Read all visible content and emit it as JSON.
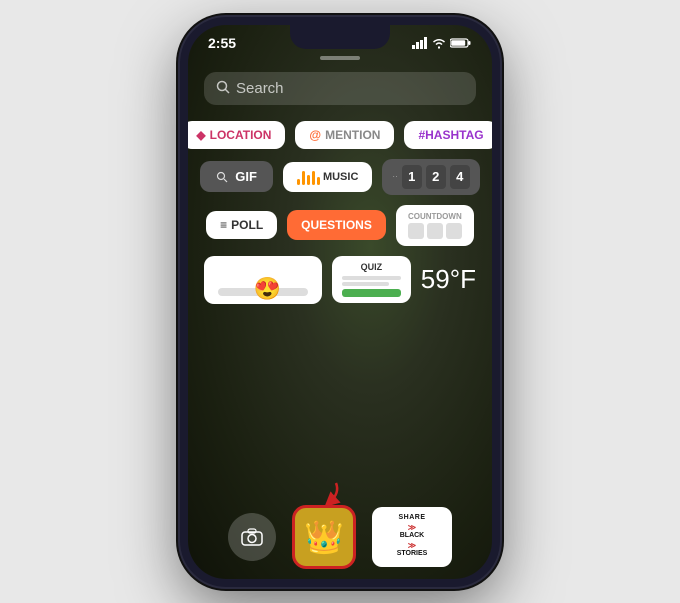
{
  "phone": {
    "status_bar": {
      "time": "2:55",
      "signal_icon": "signal",
      "wifi_icon": "wifi",
      "battery_icon": "battery"
    },
    "search": {
      "placeholder": "Search"
    },
    "stickers": {
      "row1": [
        {
          "id": "location",
          "label": "LOCATION",
          "type": "location"
        },
        {
          "id": "mention",
          "label": "@MENTION",
          "type": "mention"
        },
        {
          "id": "hashtag",
          "label": "#HASHTAG",
          "type": "hashtag"
        }
      ],
      "row2": [
        {
          "id": "gif",
          "label": "GIF",
          "type": "gif"
        },
        {
          "id": "music",
          "label": "MUSIC",
          "type": "music"
        },
        {
          "id": "counter",
          "label": "1 2 4",
          "type": "counter"
        }
      ],
      "row3": [
        {
          "id": "poll",
          "label": "POLL",
          "type": "poll"
        },
        {
          "id": "questions",
          "label": "QUESTIONS",
          "type": "questions"
        },
        {
          "id": "countdown",
          "label": "COUNTDOWN",
          "type": "countdown"
        }
      ],
      "row4": [
        {
          "id": "slider",
          "label": "slider",
          "type": "slider"
        },
        {
          "id": "quiz",
          "label": "QUIZ",
          "type": "quiz"
        },
        {
          "id": "temp",
          "label": "59°F",
          "type": "temp"
        }
      ],
      "row5": [
        {
          "id": "camera",
          "label": "camera",
          "type": "camera"
        },
        {
          "id": "crown",
          "label": "crown",
          "type": "crown"
        },
        {
          "id": "share",
          "label": "SHARE BLACK STORIES",
          "type": "share"
        }
      ]
    }
  }
}
